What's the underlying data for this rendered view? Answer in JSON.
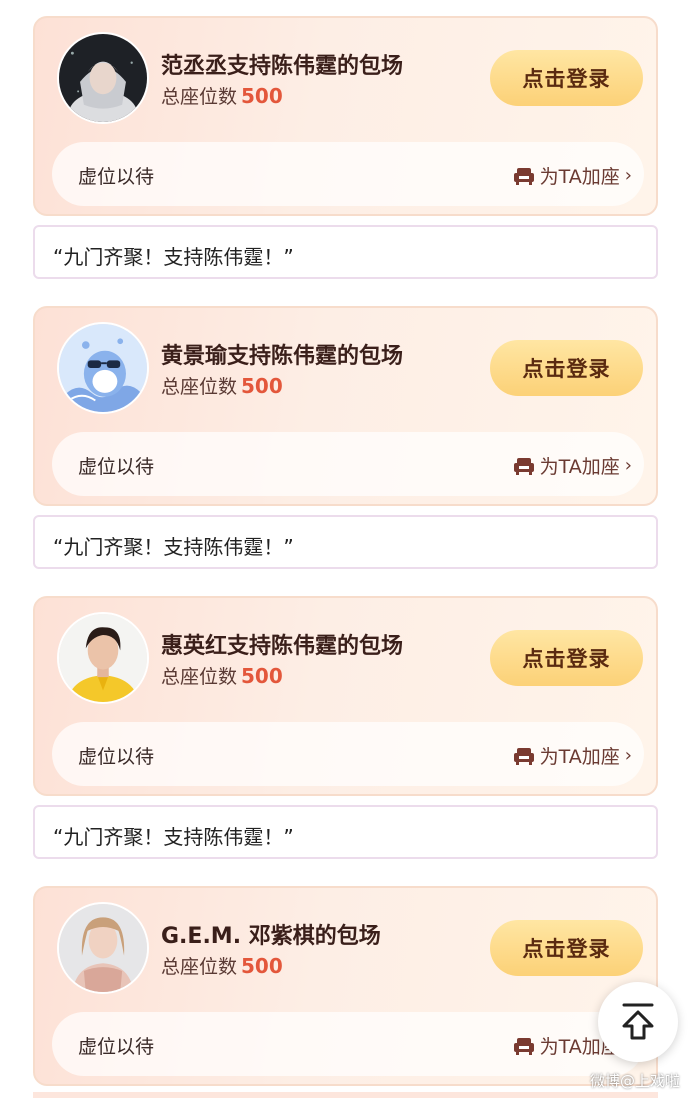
{
  "cards": [
    {
      "title": "范丞丞支持陈伟霆的包场",
      "seats_label": "总座位数",
      "seats": "500",
      "login": "点击登录",
      "empty": "虚位以待",
      "add_seat": "为TA加座",
      "quote": "“九门齐聚！支持陈伟霆！”"
    },
    {
      "title": "黄景瑜支持陈伟霆的包场",
      "seats_label": "总座位数",
      "seats": "500",
      "login": "点击登录",
      "empty": "虚位以待",
      "add_seat": "为TA加座",
      "quote": "“九门齐聚！支持陈伟霆！”"
    },
    {
      "title": "惠英红支持陈伟霆的包场",
      "seats_label": "总座位数",
      "seats": "500",
      "login": "点击登录",
      "empty": "虚位以待",
      "add_seat": "为TA加座",
      "quote": "“九门齐聚！支持陈伟霆！”"
    },
    {
      "title": "G.E.M. 邓紫棋的包场",
      "seats_label": "总座位数",
      "seats": "500",
      "login": "点击登录",
      "empty": "虚位以待",
      "add_seat": "为TA加座"
    }
  ],
  "watermark": "微博@上戏啦",
  "colors": {
    "accent": "#e3573b",
    "button": "#fcd177"
  }
}
